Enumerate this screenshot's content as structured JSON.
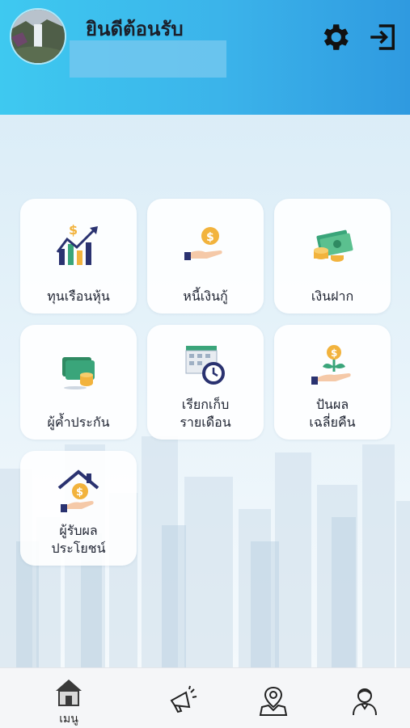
{
  "header": {
    "welcome": "ยินดีต้อนรับ",
    "user_name": "",
    "settings_icon": "gear-icon",
    "logout_icon": "logout-icon"
  },
  "menu": {
    "items": [
      {
        "label_1": "ทุนเรือนหุ้น",
        "label_2": "",
        "icon": "stock-growth-icon"
      },
      {
        "label_1": "หนี้เงินกู้",
        "label_2": "",
        "icon": "loan-coin-hand-icon"
      },
      {
        "label_1": "เงินฝาก",
        "label_2": "",
        "icon": "deposit-money-icon"
      },
      {
        "label_1": "ผู้ค้ำประกัน",
        "label_2": "",
        "icon": "guarantor-cash-icon"
      },
      {
        "label_1": "เรียกเก็บ",
        "label_2": "รายเดือน",
        "icon": "calendar-clock-icon"
      },
      {
        "label_1": "ปันผล",
        "label_2": "เฉลี่ยคืน",
        "icon": "dividend-plant-icon"
      },
      {
        "label_1": "ผู้รับผล",
        "label_2": "ประโยชน์",
        "icon": "beneficiary-house-icon"
      }
    ]
  },
  "bottom_nav": {
    "home_label": "เมนู",
    "items": [
      "home-icon",
      "megaphone-icon",
      "map-pin-icon",
      "profile-icon"
    ]
  },
  "colors": {
    "header_start": "#3ec9f0",
    "header_end": "#2f9ae0",
    "accent_gold": "#f2b33d",
    "accent_navy": "#2a3270",
    "accent_green": "#3aa57a"
  }
}
